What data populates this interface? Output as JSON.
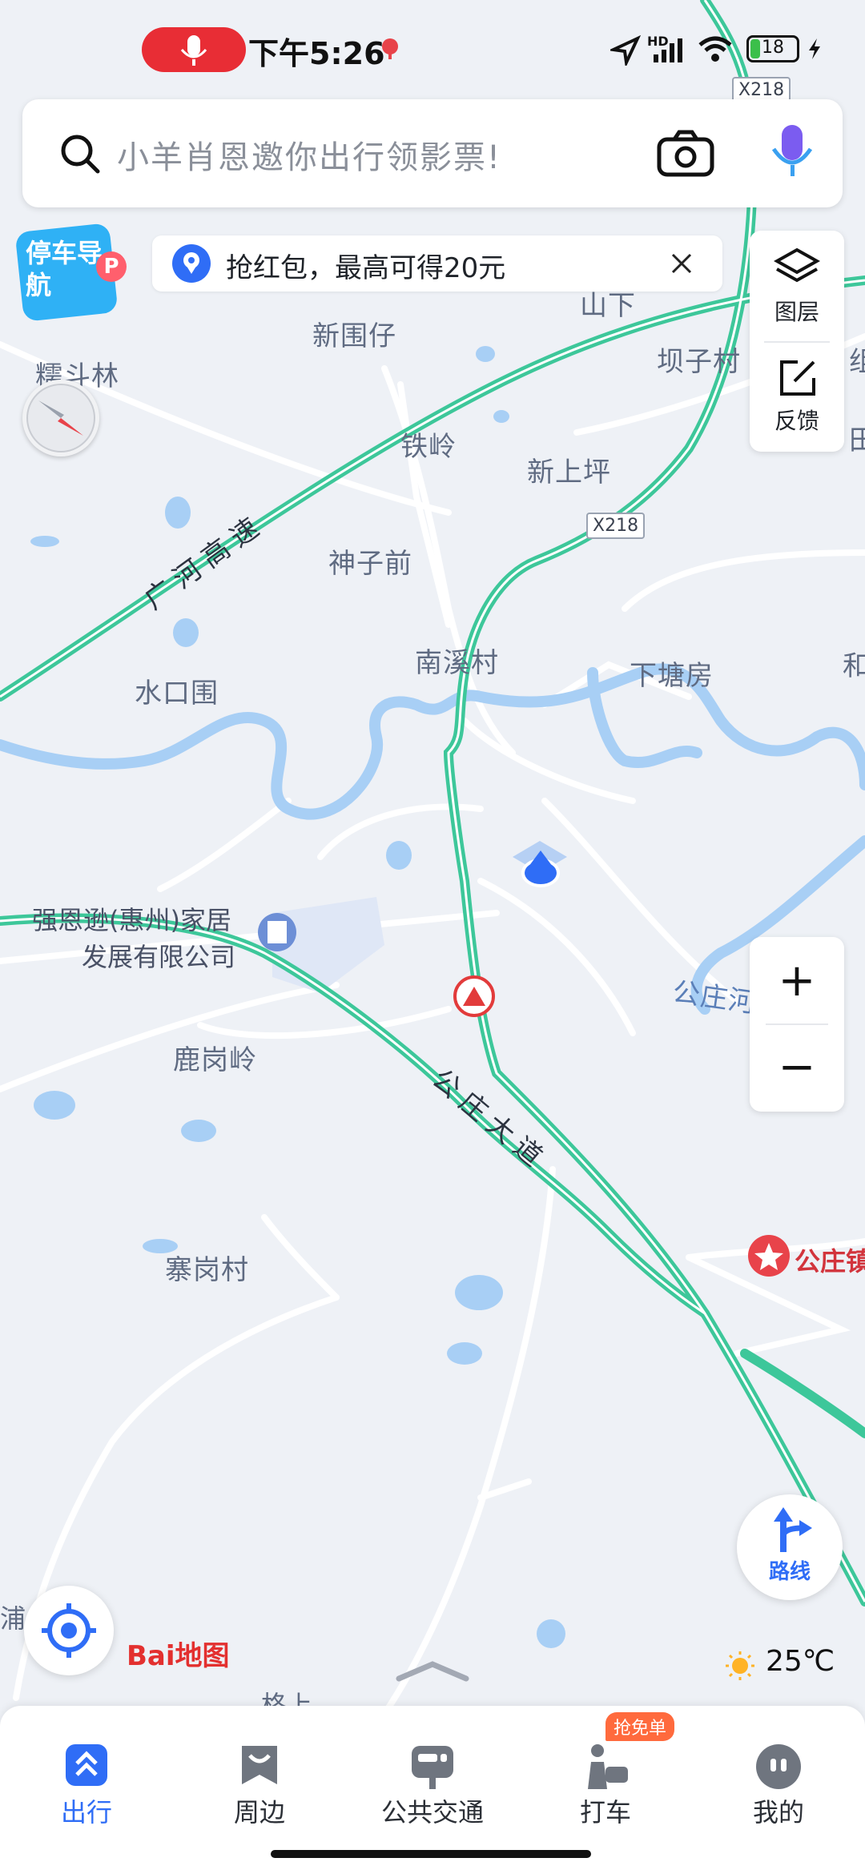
{
  "status_bar": {
    "time": "下午5:26",
    "network": "HD",
    "battery": "18"
  },
  "search": {
    "placeholder": "小羊肖恩邀你出行领影票!"
  },
  "promo": {
    "text": "抢红包，最高可得20元"
  },
  "parking_badge": "停车导航",
  "right_panel": {
    "layers_label": "图层",
    "feedback_label": "反馈"
  },
  "map": {
    "places": [
      {
        "name": "新围仔"
      },
      {
        "name": "糯斗林"
      },
      {
        "name": "铁岭"
      },
      {
        "name": "新上坪"
      },
      {
        "name": "坝子村"
      },
      {
        "name": "神子前"
      },
      {
        "name": "南溪村"
      },
      {
        "name": "下塘房"
      },
      {
        "name": "水口围"
      },
      {
        "name": "鹿岗岭"
      },
      {
        "name": "寨岗村"
      },
      {
        "name": "山下"
      },
      {
        "name": "和"
      },
      {
        "name": "组"
      },
      {
        "name": "田"
      }
    ],
    "roads": [
      {
        "name": "广河高速"
      },
      {
        "name": "公庄大道"
      },
      {
        "name": "公庄河"
      }
    ],
    "shields": [
      "X218",
      "X218"
    ],
    "pois": {
      "company_line1": "强恩逊(惠州)家居",
      "company_line2": "发展有限公司",
      "town": "公庄镇",
      "partial": "格上",
      "partial2": "浦"
    }
  },
  "zoom": {
    "in": "+",
    "out": "−"
  },
  "route_button": "路线",
  "logo": "Bai地图",
  "weather": {
    "temp": "25℃"
  },
  "bottom_nav": {
    "tabs": [
      {
        "label": "出行",
        "icon": "travel-icon",
        "active": true
      },
      {
        "label": "周边",
        "icon": "nearby-icon",
        "active": false
      },
      {
        "label": "公共交通",
        "icon": "bus-icon",
        "active": false
      },
      {
        "label": "打车",
        "icon": "taxi-icon",
        "active": false
      },
      {
        "label": "我的",
        "icon": "profile-icon",
        "active": false
      }
    ],
    "taxi_badge": "抢免单"
  },
  "colors": {
    "highway": "#3dc79a",
    "river": "#a8cff5",
    "accent": "#2f6df6",
    "map_bg": "#eef1f6"
  }
}
